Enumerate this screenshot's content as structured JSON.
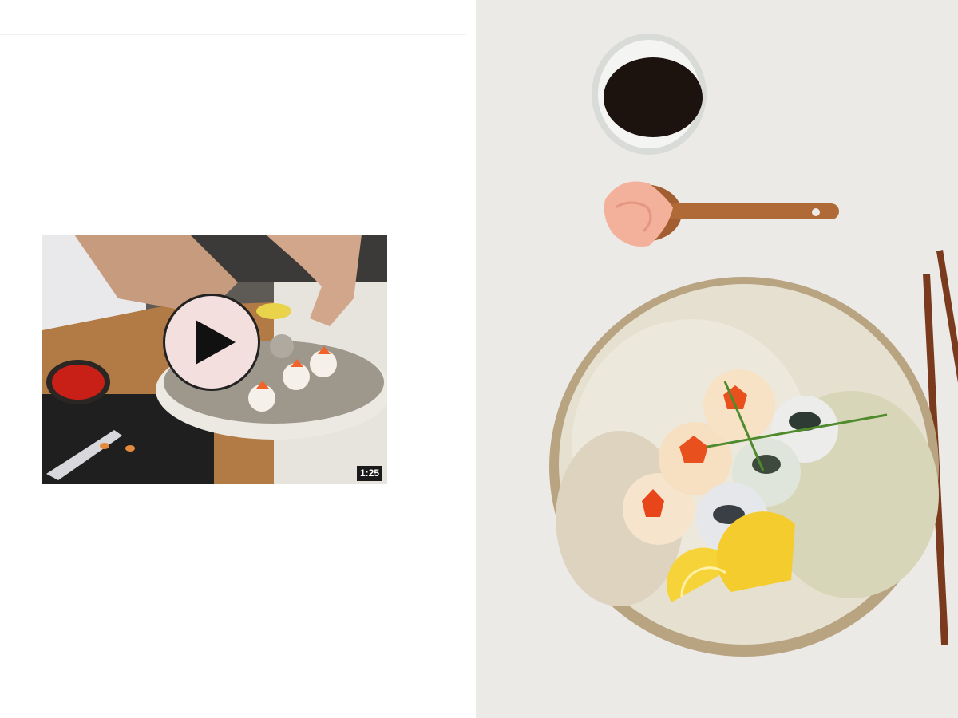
{
  "video": {
    "duration": "1:25",
    "play_icon": "play-icon"
  },
  "photo": {
    "subject": "sushi-balls-plate-photo"
  },
  "colors": {
    "play_button_fill": "#f3dfdd",
    "badge_bg": "#1a1a1a",
    "backdrop": "#eceae6"
  }
}
